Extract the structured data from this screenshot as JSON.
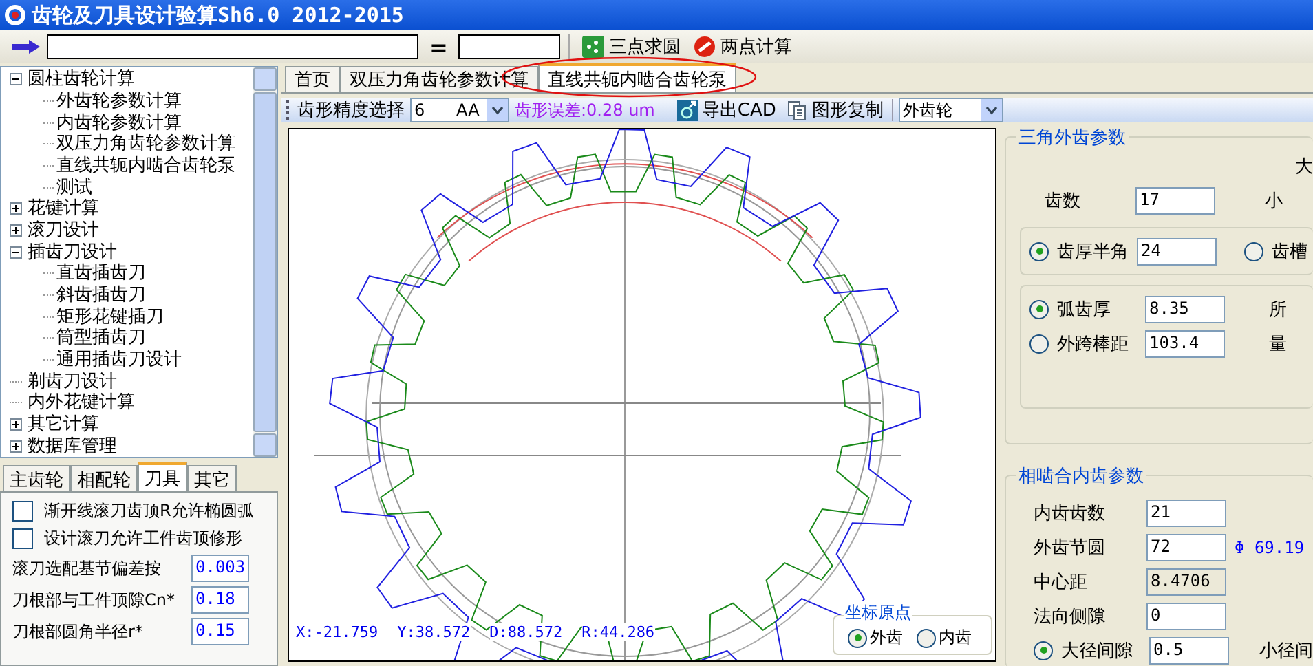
{
  "window": {
    "title": "齿轮及刀具设计验算Sh6.0  2012-2015"
  },
  "toolbar": {
    "equals": "=",
    "buttons": [
      {
        "label": "三点求圆",
        "kind": "three-point"
      },
      {
        "label": "两点计算",
        "kind": "two-point"
      }
    ]
  },
  "tree": [
    {
      "label": "圆柱齿轮计算",
      "kind": "folder",
      "expanded": true,
      "children": [
        {
          "label": "外齿轮参数计算"
        },
        {
          "label": "内齿轮参数计算"
        },
        {
          "label": "双压力角齿轮参数计算"
        },
        {
          "label": "直线共轭内啮合齿轮泵"
        },
        {
          "label": "测试"
        }
      ]
    },
    {
      "label": "花键计算",
      "kind": "folder",
      "expanded": false
    },
    {
      "label": "滚刀设计",
      "kind": "folder",
      "expanded": false
    },
    {
      "label": "插齿刀设计",
      "kind": "folder",
      "expanded": true,
      "children": [
        {
          "label": "直齿插齿刀"
        },
        {
          "label": "斜齿插齿刀"
        },
        {
          "label": "矩形花键插刀"
        },
        {
          "label": "筒型插齿刀"
        },
        {
          "label": "通用插齿刀设计"
        }
      ]
    },
    {
      "label": "剃齿刀设计",
      "kind": "leaf"
    },
    {
      "label": "内外花键计算",
      "kind": "leaf"
    },
    {
      "label": "其它计算",
      "kind": "folder",
      "expanded": false
    },
    {
      "label": "数据库管理",
      "kind": "folder",
      "expanded": false
    }
  ],
  "left_tabs": [
    {
      "label": "主齿轮",
      "selected": false
    },
    {
      "label": "相配轮",
      "selected": false
    },
    {
      "label": "刀具",
      "selected": true
    },
    {
      "label": "其它",
      "selected": false
    }
  ],
  "cutter_options": {
    "checkboxes": [
      {
        "label": "渐开线滚刀齿顶R允许椭圆弧",
        "checked": false
      },
      {
        "label": "设计滚刀允许工件齿顶修形",
        "checked": false
      }
    ],
    "fields": [
      {
        "label": "滚刀选配基节偏差按",
        "value": "0.003"
      },
      {
        "label": "刀根部与工件顶隙Cn*",
        "value": "0.18"
      },
      {
        "label": "刀根部圆角半径r*",
        "value": "0.15"
      }
    ]
  },
  "main_tabs": [
    {
      "label": "首页",
      "selected": false
    },
    {
      "label": "双压力角齿轮参数计算",
      "selected": false
    },
    {
      "label": "直线共轭内啮合齿轮泵",
      "selected": true
    }
  ],
  "view_toolbar": {
    "precision_label": "齿形精度选择",
    "precision_value": "6      AA",
    "error_text": "齿形误差:0.28 um",
    "export_button": "导出CAD",
    "copy_button": "图形复制",
    "gear_select": "外齿轮"
  },
  "canvas": {
    "readout": [
      "X:-21.759",
      "Y:38.572",
      "D:88.572",
      "R:44.286"
    ],
    "origin": {
      "title": "坐标原点",
      "options": [
        {
          "label": "外齿",
          "selected": true
        },
        {
          "label": "内齿",
          "selected": false
        }
      ]
    }
  },
  "external_params": {
    "title": "三角外齿参数",
    "corner_labels": [
      "大",
      "小"
    ],
    "teeth": {
      "label": "齿数",
      "value": "17"
    },
    "angle_options": [
      {
        "label": "齿厚半角",
        "value": "24",
        "selected": true
      },
      {
        "label": "齿槽",
        "selected": false
      }
    ],
    "thickness_options": [
      {
        "label": "弧齿厚",
        "value": "8.35",
        "selected": true,
        "side": "所"
      },
      {
        "label": "外跨棒距",
        "value": "103.4",
        "selected": false,
        "side": "量"
      }
    ]
  },
  "internal_params": {
    "title": "相啮合内齿参数",
    "rows": [
      {
        "label": "内齿齿数",
        "value": "21",
        "readonly": false
      },
      {
        "label": "外齿节圆",
        "value": "72",
        "readonly": false,
        "note": "Φ 69.19"
      },
      {
        "label": "中心距",
        "value": "8.4706",
        "readonly": true
      },
      {
        "label": "法向侧隙",
        "value": "0",
        "readonly": false
      }
    ],
    "clearance": {
      "label": "大径间隙",
      "value": "0.5",
      "selected": true,
      "side": "小径间"
    }
  }
}
